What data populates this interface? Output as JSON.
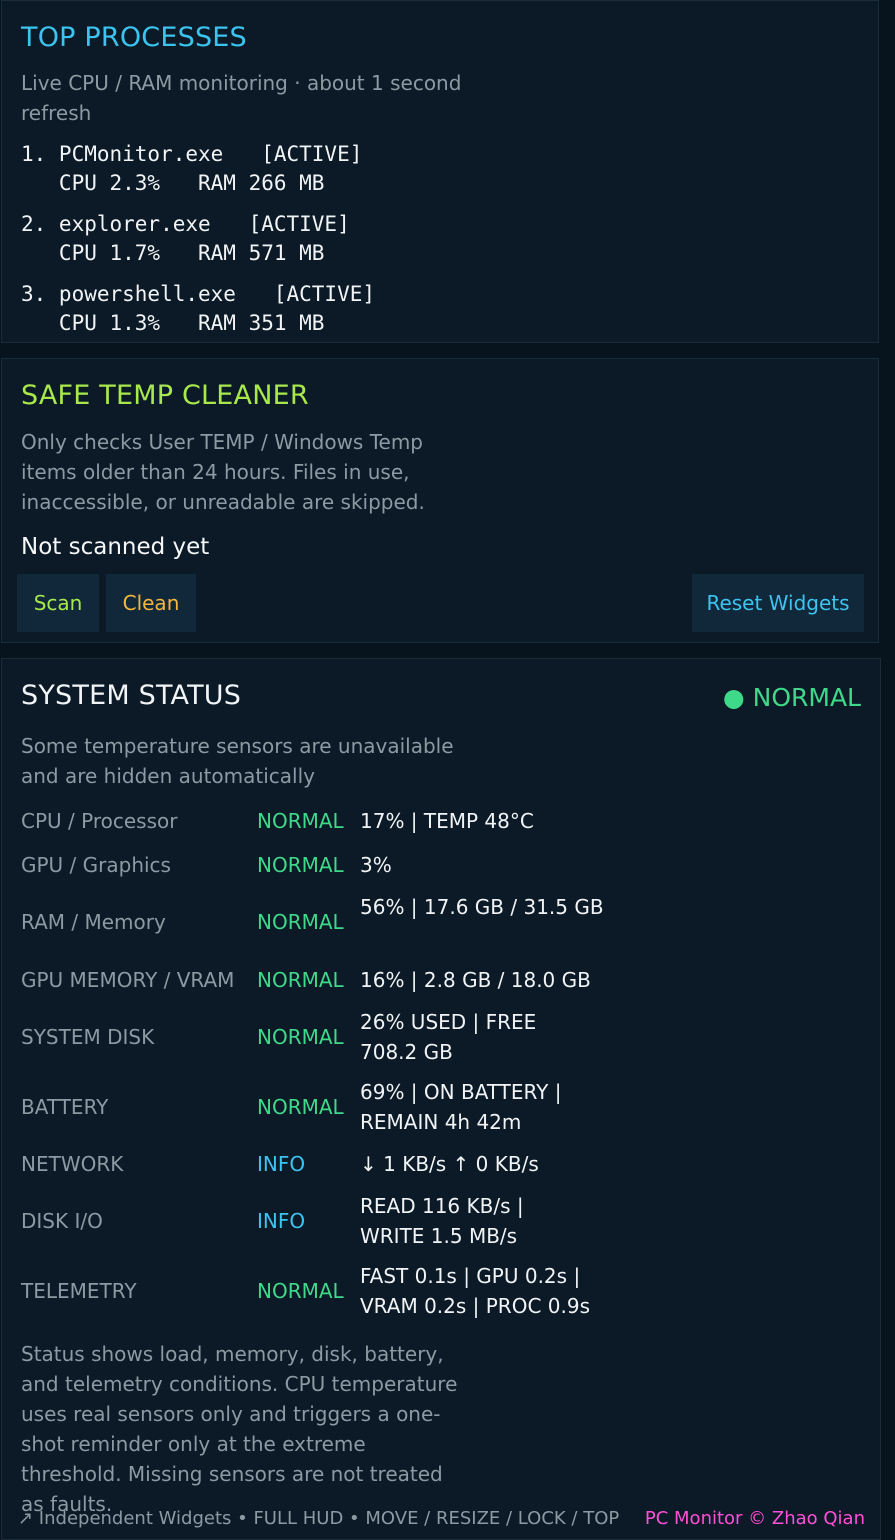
{
  "processes": {
    "title": "TOP PROCESSES",
    "subtitle": "Live CPU / RAM monitoring · about 1 second refresh",
    "items": [
      {
        "line1": "1. PCMonitor.exe   [ACTIVE]",
        "line2": "   CPU 2.3%   RAM 266 MB"
      },
      {
        "line1": "2. explorer.exe   [ACTIVE]",
        "line2": "   CPU 1.7%   RAM 571 MB"
      },
      {
        "line1": "3. powershell.exe   [ACTIVE]",
        "line2": "   CPU 1.3%   RAM 351 MB"
      }
    ]
  },
  "cleaner": {
    "title": "SAFE TEMP CLEANER",
    "subtitle": "Only checks User TEMP / Windows Temp items older than 24 hours. Files in use, inaccessible, or unreadable are skipped.",
    "status": "Not scanned yet",
    "scan_label": "Scan",
    "clean_label": "Clean",
    "reset_label": "Reset Widgets"
  },
  "status": {
    "title": "SYSTEM STATUS",
    "overall": "● NORMAL",
    "subtitle": "Some temperature sensors are unavailable and are hidden automatically",
    "rows": [
      {
        "label": "CPU / Processor",
        "state": "NORMAL",
        "value": "17%  |  TEMP 48°C"
      },
      {
        "label": "GPU / Graphics",
        "state": "NORMAL",
        "value": "3%"
      },
      {
        "label": "RAM / Memory",
        "state": "NORMAL",
        "value": "56%  |  17.6 GB / 31.5 GB"
      },
      {
        "label": "GPU MEMORY / VRAM",
        "state": "NORMAL",
        "value": "16%  |  2.8 GB / 18.0 GB"
      },
      {
        "label": "SYSTEM DISK",
        "state": "NORMAL",
        "value": "26% USED  |  FREE 708.2 GB"
      },
      {
        "label": "BATTERY",
        "state": "NORMAL",
        "value": "69%  |  ON BATTERY  |  REMAIN 4h 42m"
      },
      {
        "label": "NETWORK",
        "state": "INFO",
        "value": "↓ 1 KB/s  ↑ 0 KB/s"
      },
      {
        "label": "DISK I/O",
        "state": "INFO",
        "value": "READ 116 KB/s  |  WRITE 1.5 MB/s"
      },
      {
        "label": "TELEMETRY",
        "state": "NORMAL",
        "value": "FAST 0.1s  |  GPU 0.2s  |  VRAM 0.2s  |  PROC 0.9s"
      }
    ],
    "footnote": "Status shows load, memory, disk, battery, and telemetry conditions. CPU temperature uses real sensors only and triggers a one-shot reminder only at the extreme threshold. Missing sensors are not treated as faults."
  },
  "footer": {
    "left": "↗ Independent Widgets  •  FULL HUD  •  MOVE / RESIZE / LOCK / TOP",
    "right": "PC Monitor © Zhao Qian"
  },
  "colors": {
    "processes_title": "#3cc4f0",
    "cleaner_title": "#a8e84b",
    "normal": "#3fd98a",
    "info": "#3cc4f0",
    "clean_button": "#f3b63d",
    "footer_brand": "#ff4fd8"
  }
}
